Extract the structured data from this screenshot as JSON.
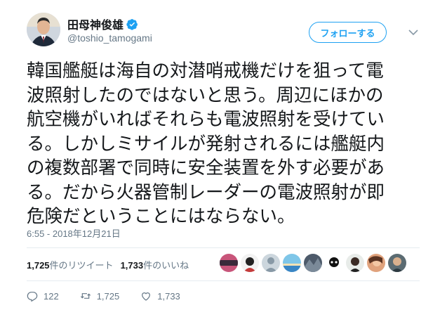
{
  "author": {
    "display_name": "田母神俊雄",
    "handle": "@toshio_tamogami",
    "avatar_icon": "avatar-icon",
    "verified_icon": "verified-icon"
  },
  "follow_button": {
    "label": "フォローする"
  },
  "tweet": {
    "lines": [
      "韓国艦艇は海自の対潜哨戒機だけを狙って電",
      "波照射したのではないと思う。周辺にほかの",
      "航空機がいればそれらも電波照射を受けてい",
      "る。しかしミサイルが発射されるには艦艇内",
      "の複数部署で同時に安全装置を外す必要があ",
      "る。だから火器管制レーダーの電波照射が即",
      "危険だということにはならない。"
    ],
    "timestamp": "6:55 - 2018年12月21日"
  },
  "stats": {
    "retweets_count": "1,725",
    "retweets_label": "件のリツイート",
    "likes_count": "1,733",
    "likes_label": "件のいいね"
  },
  "actions": {
    "reply_count": "122",
    "retweet_count": "1,725",
    "like_count": "1,733"
  },
  "colors": {
    "accent": "#1da1f2",
    "text": "#14171a",
    "muted": "#657786",
    "divider": "#e6ecf0"
  }
}
